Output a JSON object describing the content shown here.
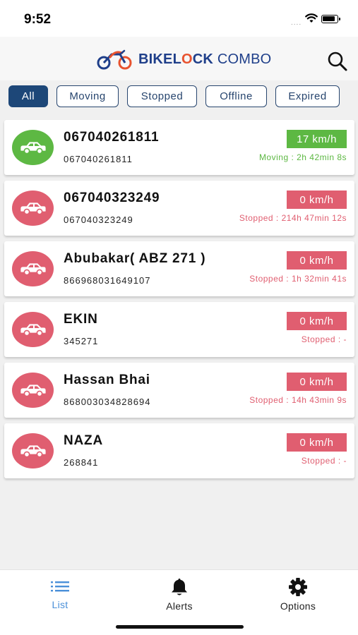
{
  "status_bar": {
    "time": "9:52",
    "signal": "....",
    "icons": [
      "wifi-icon",
      "battery-icon"
    ]
  },
  "header": {
    "brand_part1": "BIKEL",
    "brand_o": "O",
    "brand_part2": "CK",
    "brand_part3": " COMBO",
    "brand_colors": {
      "navy": "#1f3f8a",
      "orange": "#e8532f"
    },
    "search_icon": "search-icon"
  },
  "filters": [
    "All",
    "Moving",
    "Stopped",
    "Offline",
    "Expired"
  ],
  "filter_active": "All",
  "colors": {
    "moving": "#5db843",
    "stopped": "#e05e70",
    "accent": "#1d4778",
    "list_active": "#4a90d9"
  },
  "vehicles": [
    {
      "name": "067040261811",
      "id": "067040261811",
      "speed": "17 km/h",
      "state": "Moving : 2h 42min 8s",
      "status": "moving"
    },
    {
      "name": "067040323249",
      "id": "067040323249",
      "speed": "0 km/h",
      "state": "Stopped : 214h 47min 12s",
      "status": "stopped"
    },
    {
      "name": "Abubakar( ABZ 271 )",
      "id": "866968031649107",
      "speed": "0 km/h",
      "state": "Stopped : 1h 32min 41s",
      "status": "stopped"
    },
    {
      "name": "EKIN",
      "id": "345271",
      "speed": "0 km/h",
      "state": "Stopped : -",
      "status": "stopped"
    },
    {
      "name": "Hassan Bhai",
      "id": "868003034828694",
      "speed": "0 km/h",
      "state": "Stopped : 14h 43min 9s",
      "status": "stopped"
    },
    {
      "name": "NAZA",
      "id": "268841",
      "speed": "0 km/h",
      "state": "Stopped : -",
      "status": "stopped"
    }
  ],
  "tabs": [
    {
      "label": "List",
      "icon": "list-icon",
      "active": true
    },
    {
      "label": "Alerts",
      "icon": "bell-icon",
      "active": false
    },
    {
      "label": "Options",
      "icon": "gear-icon",
      "active": false
    }
  ]
}
